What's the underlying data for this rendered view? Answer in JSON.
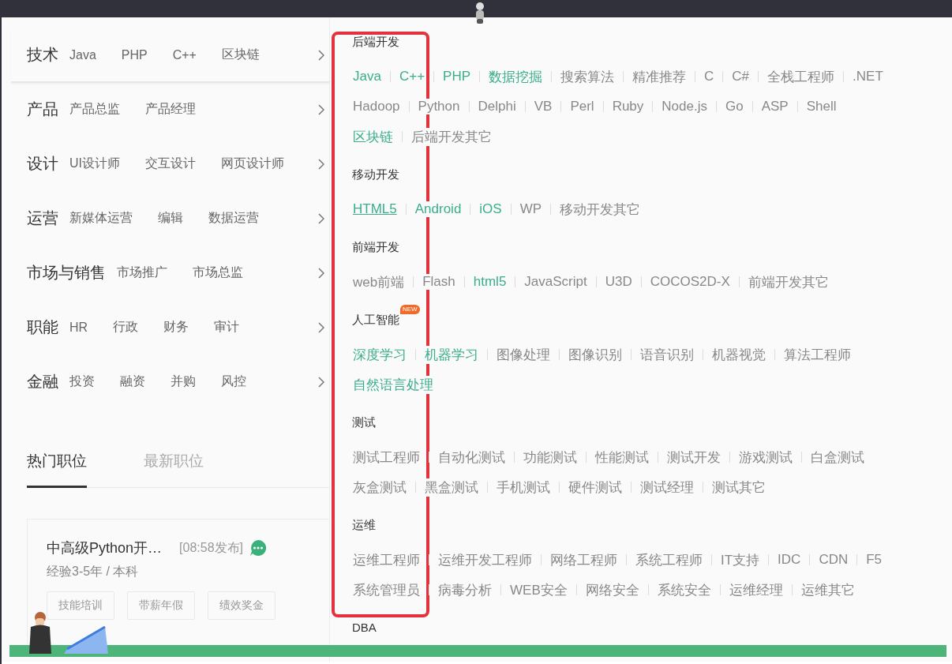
{
  "categories": [
    {
      "title": "技术",
      "items": [
        "Java",
        "PHP",
        "C++",
        "区块链"
      ],
      "selected": true
    },
    {
      "title": "产品",
      "items": [
        "产品总监",
        "产品经理"
      ],
      "selected": false
    },
    {
      "title": "设计",
      "items": [
        "UI设计师",
        "交互设计",
        "网页设计师"
      ],
      "selected": false
    },
    {
      "title": "运营",
      "items": [
        "新媒体运营",
        "编辑",
        "数据运营"
      ],
      "selected": false
    },
    {
      "title": "市场与销售",
      "items": [
        "市场推广",
        "市场总监"
      ],
      "selected": false
    },
    {
      "title": "职能",
      "items": [
        "HR",
        "行政",
        "财务",
        "审计"
      ],
      "selected": false
    },
    {
      "title": "金融",
      "items": [
        "投资",
        "融资",
        "并购",
        "风控"
      ],
      "selected": false
    }
  ],
  "tabs": [
    {
      "label": "热门职位",
      "selected": true
    },
    {
      "label": "最新职位",
      "selected": false
    }
  ],
  "job_card": {
    "title": "中高级Python开…",
    "time": "[08:58发布]",
    "meta": "经验3-5年 / 本科",
    "tags": [
      "技能培训",
      "带薪年假",
      "绩效奖金"
    ]
  },
  "sections": [
    {
      "title": "后端开发",
      "tags": [
        {
          "label": "Java",
          "hot": true
        },
        {
          "label": "C++",
          "hot": true
        },
        {
          "label": "PHP",
          "hot": true
        },
        {
          "label": "数据挖掘",
          "hot": true
        },
        {
          "label": "搜索算法",
          "hot": false
        },
        {
          "label": "精准推荐",
          "hot": false
        },
        {
          "label": "C",
          "hot": false
        },
        {
          "label": "C#",
          "hot": false
        },
        {
          "label": "全栈工程师",
          "hot": false
        },
        {
          "label": ".NET",
          "hot": false
        },
        {
          "label": "Hadoop",
          "hot": false
        },
        {
          "label": "Python",
          "hot": false
        },
        {
          "label": "Delphi",
          "hot": false
        },
        {
          "label": "VB",
          "hot": false
        },
        {
          "label": "Perl",
          "hot": false
        },
        {
          "label": "Ruby",
          "hot": false
        },
        {
          "label": "Node.js",
          "hot": false
        },
        {
          "label": "Go",
          "hot": false
        },
        {
          "label": "ASP",
          "hot": false
        },
        {
          "label": "Shell",
          "hot": false
        },
        {
          "label": "区块链",
          "hot": true
        },
        {
          "label": "后端开发其它",
          "hot": false
        }
      ]
    },
    {
      "title": "移动开发",
      "tags": [
        {
          "label": "HTML5",
          "hot": true,
          "hovered": true
        },
        {
          "label": "Android",
          "hot": true
        },
        {
          "label": "iOS",
          "hot": true
        },
        {
          "label": "WP",
          "hot": false
        },
        {
          "label": "移动开发其它",
          "hot": false
        }
      ]
    },
    {
      "title": "前端开发",
      "tags": [
        {
          "label": "web前端",
          "hot": false
        },
        {
          "label": "Flash",
          "hot": false
        },
        {
          "label": "html5",
          "hot": true
        },
        {
          "label": "JavaScript",
          "hot": false
        },
        {
          "label": "U3D",
          "hot": false
        },
        {
          "label": "COCOS2D-X",
          "hot": false
        },
        {
          "label": "前端开发其它",
          "hot": false
        }
      ]
    },
    {
      "title": "人工智能",
      "badge": "NEW",
      "tags": [
        {
          "label": "深度学习",
          "hot": true
        },
        {
          "label": "机器学习",
          "hot": true
        },
        {
          "label": "图像处理",
          "hot": false
        },
        {
          "label": "图像识别",
          "hot": false
        },
        {
          "label": "语音识别",
          "hot": false
        },
        {
          "label": "机器视觉",
          "hot": false
        },
        {
          "label": "算法工程师",
          "hot": false
        },
        {
          "label": "自然语言处理",
          "hot": true
        }
      ]
    },
    {
      "title": "测试",
      "tags": [
        {
          "label": "测试工程师",
          "hot": false
        },
        {
          "label": "自动化测试",
          "hot": false
        },
        {
          "label": "功能测试",
          "hot": false
        },
        {
          "label": "性能测试",
          "hot": false
        },
        {
          "label": "测试开发",
          "hot": false
        },
        {
          "label": "游戏测试",
          "hot": false
        },
        {
          "label": "白盒测试",
          "hot": false
        },
        {
          "label": "灰盒测试",
          "hot": false
        },
        {
          "label": "黑盒测试",
          "hot": false
        },
        {
          "label": "手机测试",
          "hot": false
        },
        {
          "label": "硬件测试",
          "hot": false
        },
        {
          "label": "测试经理",
          "hot": false
        },
        {
          "label": "测试其它",
          "hot": false
        }
      ]
    },
    {
      "title": "运维",
      "tags": [
        {
          "label": "运维工程师",
          "hot": false
        },
        {
          "label": "运维开发工程师",
          "hot": false
        },
        {
          "label": "网络工程师",
          "hot": false
        },
        {
          "label": "系统工程师",
          "hot": false
        },
        {
          "label": "IT支持",
          "hot": false
        },
        {
          "label": "IDC",
          "hot": false
        },
        {
          "label": "CDN",
          "hot": false
        },
        {
          "label": "F5",
          "hot": false
        },
        {
          "label": "系统管理员",
          "hot": false
        },
        {
          "label": "病毒分析",
          "hot": false
        },
        {
          "label": "WEB安全",
          "hot": false
        },
        {
          "label": "网络安全",
          "hot": false
        },
        {
          "label": "系统安全",
          "hot": false
        },
        {
          "label": "运维经理",
          "hot": false
        },
        {
          "label": "运维其它",
          "hot": false
        }
      ]
    },
    {
      "title": "DBA"
    }
  ],
  "annotation": {
    "kind": "highlight-box"
  }
}
